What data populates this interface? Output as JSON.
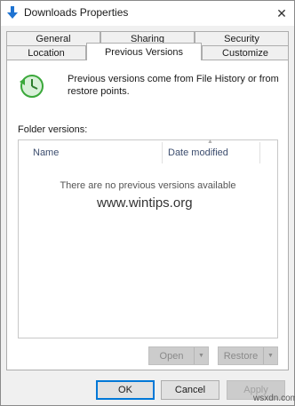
{
  "window": {
    "title": "Downloads Properties"
  },
  "tabs": {
    "row1": [
      {
        "label": "General"
      },
      {
        "label": "Sharing"
      },
      {
        "label": "Security"
      }
    ],
    "row2": [
      {
        "label": "Location"
      },
      {
        "label": "Previous Versions",
        "active": true
      },
      {
        "label": "Customize"
      }
    ]
  },
  "panel": {
    "info_text": "Previous versions come from File History or from restore points.",
    "folder_versions_label": "Folder versions:",
    "list": {
      "columns": [
        "Name",
        "Date modified"
      ],
      "empty_message": "There are no previous versions available"
    },
    "open_button": "Open",
    "restore_button": "Restore"
  },
  "dialog_buttons": {
    "ok": "OK",
    "cancel": "Cancel",
    "apply": "Apply"
  },
  "overlays": {
    "watermark": "www.wintips.org",
    "corner_mark": "wsxdn.com"
  },
  "colors": {
    "accent": "#0078d7",
    "icon_green": "#3aa83a",
    "title_icon_blue": "#1e73d2"
  }
}
